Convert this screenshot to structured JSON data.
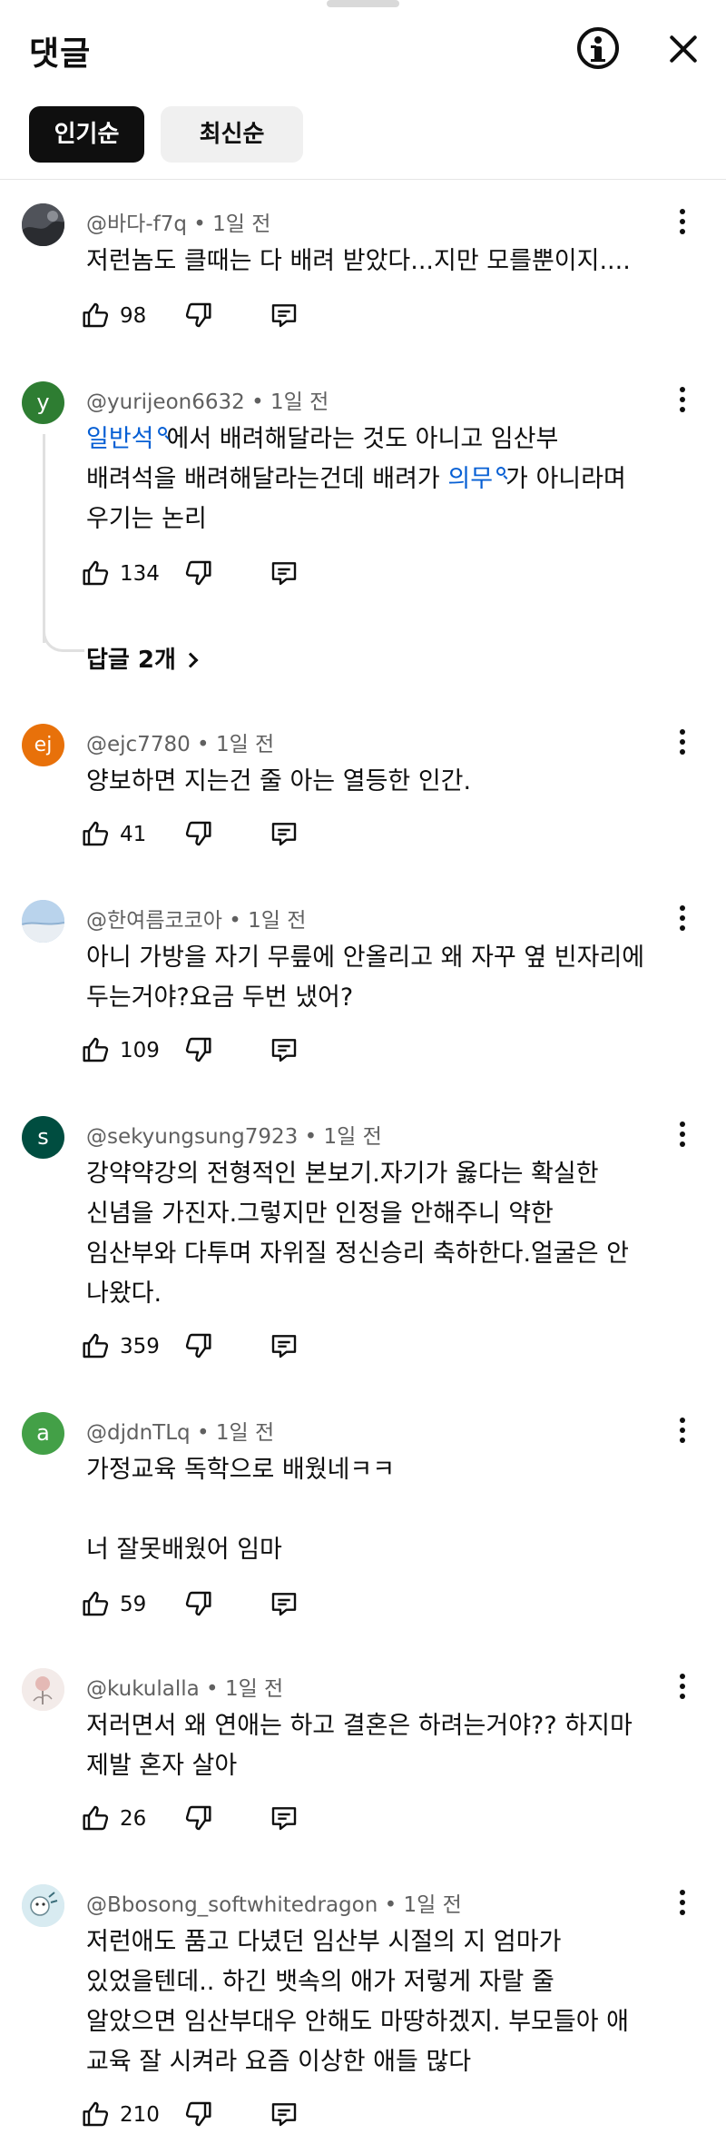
{
  "header": {
    "title": "댓글"
  },
  "sort_chips": {
    "popular": "인기순",
    "newest": "최신순"
  },
  "comments": [
    {
      "author": "@바다-f7q",
      "time": "1일 전",
      "avatar": {
        "type": "photo",
        "color": "#4a4d52"
      },
      "lines": [
        "저런놈도 클때는 다 배려 받았다...지만 모를뿐이지...."
      ],
      "likes": "98"
    },
    {
      "author": "@yurijeon6632",
      "time": "1일 전",
      "avatar": {
        "type": "letter",
        "letter": "y",
        "color": "#2e7d32"
      },
      "line1_link": "일반석",
      "line1_rest": "에서 배려해달라는 것도 아니고 임산부",
      "line2_pre": "배려석을 배려해달라는건데 배려가 ",
      "line2_link": "의무",
      "line2_post": "가 아니라며",
      "line3": "우기는 논리",
      "likes": "134",
      "replies": "답글 2개"
    },
    {
      "author": "@ejc7780",
      "time": "1일 전",
      "avatar": {
        "type": "letter",
        "letter": "ej",
        "color": "#e8710a"
      },
      "lines": [
        "양보하면 지는건 줄 아는 열등한 인간."
      ],
      "likes": "41"
    },
    {
      "author": "@한여름코코아",
      "time": "1일 전",
      "avatar": {
        "type": "photo",
        "color": "#a9c6e3"
      },
      "lines": [
        "아니 가방을 자기 무릎에 안올리고 왜 자꾸 옆 빈자리에",
        "두는거야?요금 두번 냈어?"
      ],
      "likes": "109"
    },
    {
      "author": "@sekyungsung7923",
      "time": "1일 전",
      "avatar": {
        "type": "letter",
        "letter": "s",
        "color": "#004d40"
      },
      "lines": [
        "강약약강의 전형적인 본보기.자기가 옳다는 확실한",
        "신념을 가진자.그렇지만 인정을 안해주니 약한",
        "임산부와 다투며 자위질 정신승리 축하한다.얼굴은 안",
        "나왔다."
      ],
      "likes": "359"
    },
    {
      "author": "@djdnTLq",
      "time": "1일 전",
      "avatar": {
        "type": "letter",
        "letter": "a",
        "color": "#43a047"
      },
      "lines": [
        "가정교육 독학으로 배웠네ㅋㅋ",
        "",
        "너 잘못배웠어 임마"
      ],
      "likes": "59"
    },
    {
      "author": "@kukulalla",
      "time": "1일 전",
      "avatar": {
        "type": "photo",
        "color": "#f1e6e4"
      },
      "lines": [
        "저러면서 왜 연애는 하고 결혼은 하려는거야?? 하지마",
        "제발 혼자 살아"
      ],
      "likes": "26"
    },
    {
      "author": "@Bbosong_softwhitedragon",
      "time": "1일 전",
      "avatar": {
        "type": "photo",
        "color": "#cfe3ea"
      },
      "lines": [
        "저런애도 품고 다녔던 임산부 시절의 지 엄마가",
        "있었을텐데.. 하긴 뱃속의 애가 저렇게 자랄 줄",
        "알았으면 임산부대우 안해도 마땅하겠지. 부모들아 애",
        "교육 잘 시켜라 요즘 이상한 애들 많다"
      ],
      "likes": "210"
    }
  ]
}
